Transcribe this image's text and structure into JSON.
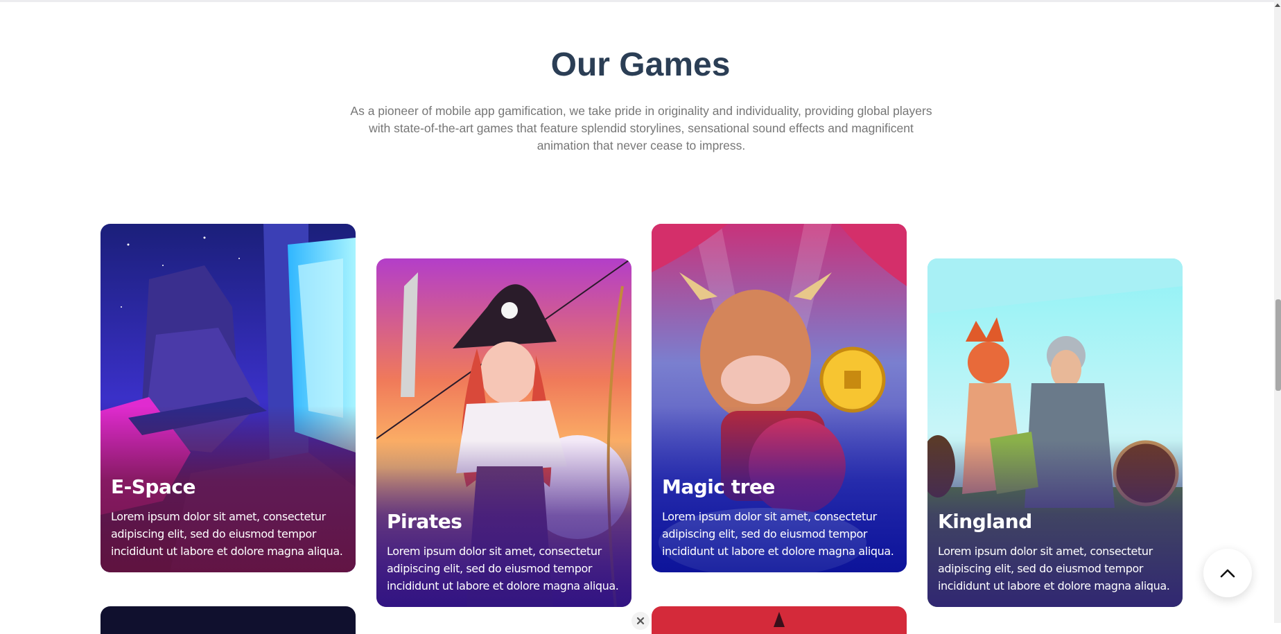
{
  "section": {
    "title": "Our Games",
    "description": "As a pioneer of mobile app gamification, we take pride in originality and individuality, providing global players with state-of-the-art games that feature splendid storylines, sensational sound effects and magnificent animation that never cease to impress."
  },
  "games": [
    {
      "title": "E-Space",
      "text": "Lorem ipsum dolor sit amet, consectetur adipiscing elit, sed do eiusmod tempor incididunt ut labore et dolore magna aliqua."
    },
    {
      "title": "Pirates",
      "text": "Lorem ipsum dolor sit amet, consectetur adipiscing elit, sed do eiusmod tempor incididunt ut labore et dolore magna aliqua."
    },
    {
      "title": "Magic tree",
      "text": "Lorem ipsum dolor sit amet, consectetur adipiscing elit, sed do eiusmod tempor incididunt ut labore et dolore magna aliqua."
    },
    {
      "title": "Kingland",
      "text": "Lorem ipsum dolor sit amet, consectetur adipiscing elit, sed do eiusmod tempor incididunt ut labore et dolore magna aliqua."
    }
  ],
  "icons": {
    "back_to_top": "chevron-up-icon",
    "close": "close-icon",
    "scroll_up": "scroll-up-arrow-icon"
  },
  "colors": {
    "title": "#2b3e55",
    "description": "#767676",
    "card_text": "#ffffff"
  }
}
